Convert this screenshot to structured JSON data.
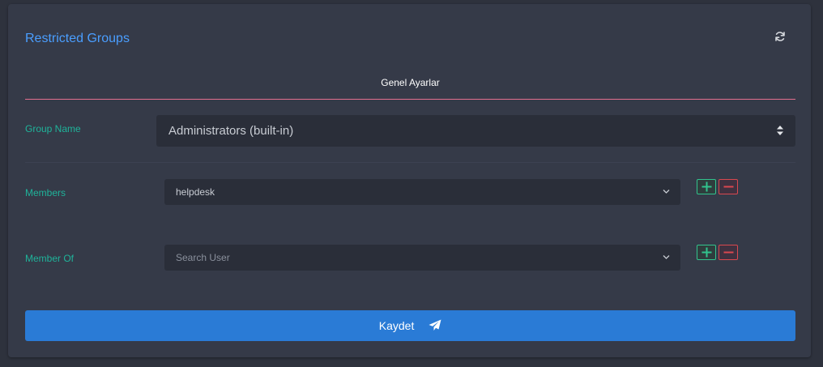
{
  "panel": {
    "title": "Restricted Groups",
    "refresh_icon": "refresh-icon"
  },
  "tabs": [
    {
      "label": "Genel Ayarlar",
      "active": true
    }
  ],
  "form": {
    "group_name": {
      "label": "Group Name",
      "value": "Administrators (built-in)"
    },
    "members": {
      "label": "Members",
      "value": "helpdesk",
      "add_icon": "plus-icon",
      "remove_icon": "minus-icon"
    },
    "member_of": {
      "label": "Member Of",
      "placeholder": "Search User",
      "add_icon": "plus-icon",
      "remove_icon": "minus-icon"
    }
  },
  "submit": {
    "label": "Kaydet",
    "icon": "send-icon"
  },
  "colors": {
    "accent": "#4a9eff",
    "label": "#1fb39a",
    "tab_underline": "#e36f8f",
    "add": "#31c48d",
    "remove": "#d9484f",
    "submit": "#2a7bd6"
  }
}
